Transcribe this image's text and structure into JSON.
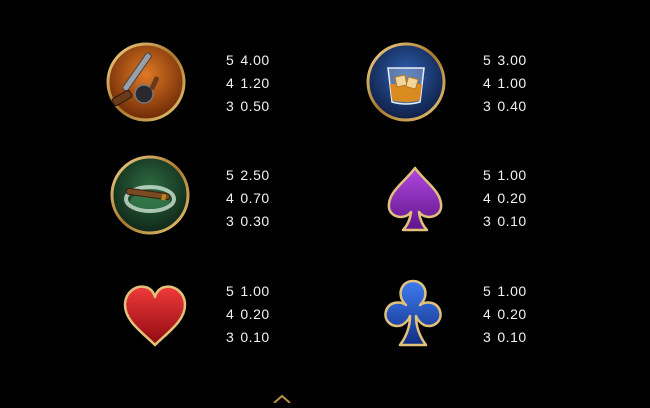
{
  "symbols": [
    {
      "icon": "tommy-gun-icon",
      "payouts": [
        {
          "count": "5",
          "value": "4.00"
        },
        {
          "count": "4",
          "value": "1.20"
        },
        {
          "count": "3",
          "value": "0.50"
        }
      ]
    },
    {
      "icon": "whiskey-glass-icon",
      "payouts": [
        {
          "count": "5",
          "value": "3.00"
        },
        {
          "count": "4",
          "value": "1.00"
        },
        {
          "count": "3",
          "value": "0.40"
        }
      ]
    },
    {
      "icon": "cigar-ashtray-icon",
      "payouts": [
        {
          "count": "5",
          "value": "2.50"
        },
        {
          "count": "4",
          "value": "0.70"
        },
        {
          "count": "3",
          "value": "0.30"
        }
      ]
    },
    {
      "icon": "spade-icon",
      "payouts": [
        {
          "count": "5",
          "value": "1.00"
        },
        {
          "count": "4",
          "value": "0.20"
        },
        {
          "count": "3",
          "value": "0.10"
        }
      ]
    },
    {
      "icon": "heart-icon",
      "payouts": [
        {
          "count": "5",
          "value": "1.00"
        },
        {
          "count": "4",
          "value": "0.20"
        },
        {
          "count": "3",
          "value": "0.10"
        }
      ]
    },
    {
      "icon": "club-icon",
      "payouts": [
        {
          "count": "5",
          "value": "1.00"
        },
        {
          "count": "4",
          "value": "0.20"
        },
        {
          "count": "3",
          "value": "0.10"
        }
      ]
    }
  ],
  "colors": {
    "background": "#000000",
    "gold_frame": "#c9a25a",
    "text": "#f2f2f2",
    "gun_bg": "#b3510f",
    "whiskey_bg": "#1f3e78",
    "cigar_bg": "#1f4a2e",
    "spade": "#8e2bc0",
    "heart": "#d4111a",
    "club": "#1f55c9"
  }
}
